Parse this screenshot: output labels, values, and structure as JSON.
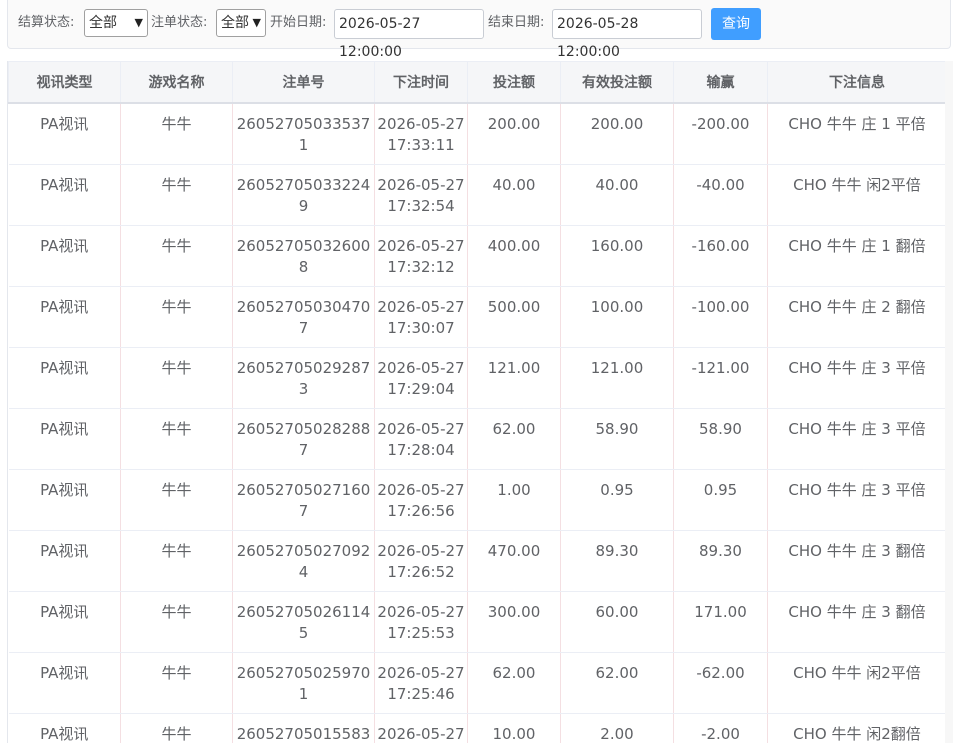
{
  "filters": {
    "settle_label": "结算状态:",
    "settle_value": "全部",
    "order_label": "注单状态:",
    "order_value": "全部",
    "start_label": "开始日期:",
    "start_value": "2026-05-27 12:00:00",
    "end_label": "结束日期:",
    "end_value": "2026-05-28 12:00:00",
    "query_button": "查询"
  },
  "table": {
    "headers": [
      "视讯类型",
      "游戏名称",
      "注单号",
      "下注时间",
      "投注额",
      "有效投注额",
      "输赢",
      "下注信息"
    ],
    "rows": [
      {
        "type": "PA视讯",
        "game": "牛牛",
        "order_no": "260527050335371",
        "time": "2026-05-27 17:33:11",
        "bet": "200.00",
        "valid": "200.00",
        "win": "-200.00",
        "info": "CHO 牛牛 庄 1 平倍"
      },
      {
        "type": "PA视讯",
        "game": "牛牛",
        "order_no": "260527050332249",
        "time": "2026-05-27 17:32:54",
        "bet": "40.00",
        "valid": "40.00",
        "win": "-40.00",
        "info": "CHO 牛牛 闲2平倍"
      },
      {
        "type": "PA视讯",
        "game": "牛牛",
        "order_no": "260527050326008",
        "time": "2026-05-27 17:32:12",
        "bet": "400.00",
        "valid": "160.00",
        "win": "-160.00",
        "info": "CHO 牛牛 庄 1 翻倍"
      },
      {
        "type": "PA视讯",
        "game": "牛牛",
        "order_no": "260527050304707",
        "time": "2026-05-27 17:30:07",
        "bet": "500.00",
        "valid": "100.00",
        "win": "-100.00",
        "info": "CHO 牛牛 庄 2 翻倍"
      },
      {
        "type": "PA视讯",
        "game": "牛牛",
        "order_no": "260527050292873",
        "time": "2026-05-27 17:29:04",
        "bet": "121.00",
        "valid": "121.00",
        "win": "-121.00",
        "info": "CHO 牛牛 庄 3 平倍"
      },
      {
        "type": "PA视讯",
        "game": "牛牛",
        "order_no": "260527050282887",
        "time": "2026-05-27 17:28:04",
        "bet": "62.00",
        "valid": "58.90",
        "win": "58.90",
        "info": "CHO 牛牛 庄 3 平倍"
      },
      {
        "type": "PA视讯",
        "game": "牛牛",
        "order_no": "260527050271607",
        "time": "2026-05-27 17:26:56",
        "bet": "1.00",
        "valid": "0.95",
        "win": "0.95",
        "info": "CHO 牛牛 庄 3 平倍"
      },
      {
        "type": "PA视讯",
        "game": "牛牛",
        "order_no": "260527050270924",
        "time": "2026-05-27 17:26:52",
        "bet": "470.00",
        "valid": "89.30",
        "win": "89.30",
        "info": "CHO 牛牛 庄 3 翻倍"
      },
      {
        "type": "PA视讯",
        "game": "牛牛",
        "order_no": "260527050261145",
        "time": "2026-05-27 17:25:53",
        "bet": "300.00",
        "valid": "60.00",
        "win": "171.00",
        "info": "CHO 牛牛 庄 3 翻倍"
      },
      {
        "type": "PA视讯",
        "game": "牛牛",
        "order_no": "260527050259701",
        "time": "2026-05-27 17:25:46",
        "bet": "62.00",
        "valid": "62.00",
        "win": "-62.00",
        "info": "CHO 牛牛 闲2平倍"
      },
      {
        "type": "PA视讯",
        "game": "牛牛",
        "order_no": "26052705015583",
        "time": "2026-05-27",
        "bet": "10.00",
        "valid": "2.00",
        "win": "-2.00",
        "info": "CHO 牛牛 闲2翻倍"
      }
    ]
  }
}
